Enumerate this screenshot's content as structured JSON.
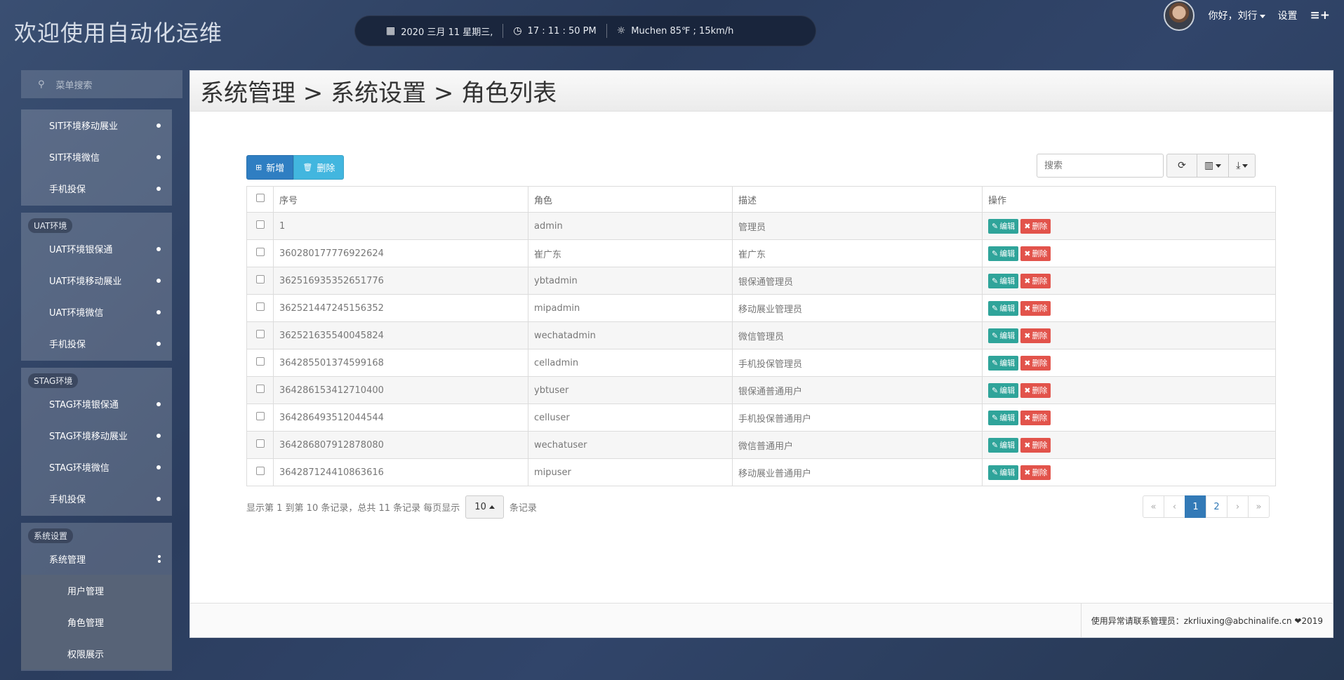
{
  "header": {
    "brand": "欢迎使用自动化运维",
    "date": "2020 三月 11 星期三,",
    "time": "17 : 11 : 50 PM",
    "weather": "Muchen 85℉ ; 15km/h",
    "user_greeting": "你好，刘行",
    "settings_label": "设置",
    "menu_icon": "≡+"
  },
  "sidebar": {
    "search_placeholder": "菜单搜索",
    "groups": [
      {
        "badge": "",
        "items": [
          "SIT环境移动展业",
          "SIT环境微信",
          "手机投保"
        ]
      },
      {
        "badge": "UAT环境",
        "items": [
          "UAT环境银保通",
          "UAT环境移动展业",
          "UAT环境微信",
          "手机投保"
        ]
      },
      {
        "badge": "STAG环境",
        "items": [
          "STAG环境银保通",
          "STAG环境移动展业",
          "STAG环境微信",
          "手机投保"
        ]
      },
      {
        "badge": "系统设置",
        "items": [
          "系统管理"
        ],
        "subitems": [
          "用户管理",
          "角色管理",
          "权限展示"
        ]
      }
    ]
  },
  "main": {
    "title": "系统管理 > 系统设置 > 角色列表",
    "add_label": "新增",
    "delete_label": "删除",
    "search_placeholder": "搜索",
    "columns": [
      "序号",
      "角色",
      "描述",
      "操作"
    ],
    "edit_label": "编辑",
    "row_delete_label": "删除",
    "rows": [
      [
        "1",
        "admin",
        "管理员"
      ],
      [
        "360280177776922624",
        "崔广东",
        "崔广东"
      ],
      [
        "362516935352651776",
        "ybtadmin",
        "银保通管理员"
      ],
      [
        "362521447245156352",
        "mipadmin",
        "移动展业管理员"
      ],
      [
        "362521635540045824",
        "wechatadmin",
        "微信管理员"
      ],
      [
        "364285501374599168",
        "celladmin",
        "手机投保管理员"
      ],
      [
        "364286153412710400",
        "ybtuser",
        "银保通普通用户"
      ],
      [
        "364286493512044544",
        "celluser",
        "手机投保普通用户"
      ],
      [
        "364286807912878080",
        "wechatuser",
        "微信普通用户"
      ],
      [
        "364287124410863616",
        "mipuser",
        "移动展业普通用户"
      ]
    ],
    "pager_text": "显示第 1 到第 10 条记录，总共 11 条记录 每页显示",
    "page_size": "10",
    "pager_suffix": "条记录",
    "pages": [
      "«",
      "‹",
      "1",
      "2",
      "›",
      "»"
    ],
    "active_page": "1"
  },
  "footer": {
    "text": "使用异常请联系管理员：zkrliuxing@abchinalife.cn ❤2019"
  },
  "colors": {
    "primary": "#2f7ec2",
    "info": "#42b6df",
    "edit": "#2fa49a",
    "delete": "#e2534b",
    "page_active": "#337ab7"
  }
}
